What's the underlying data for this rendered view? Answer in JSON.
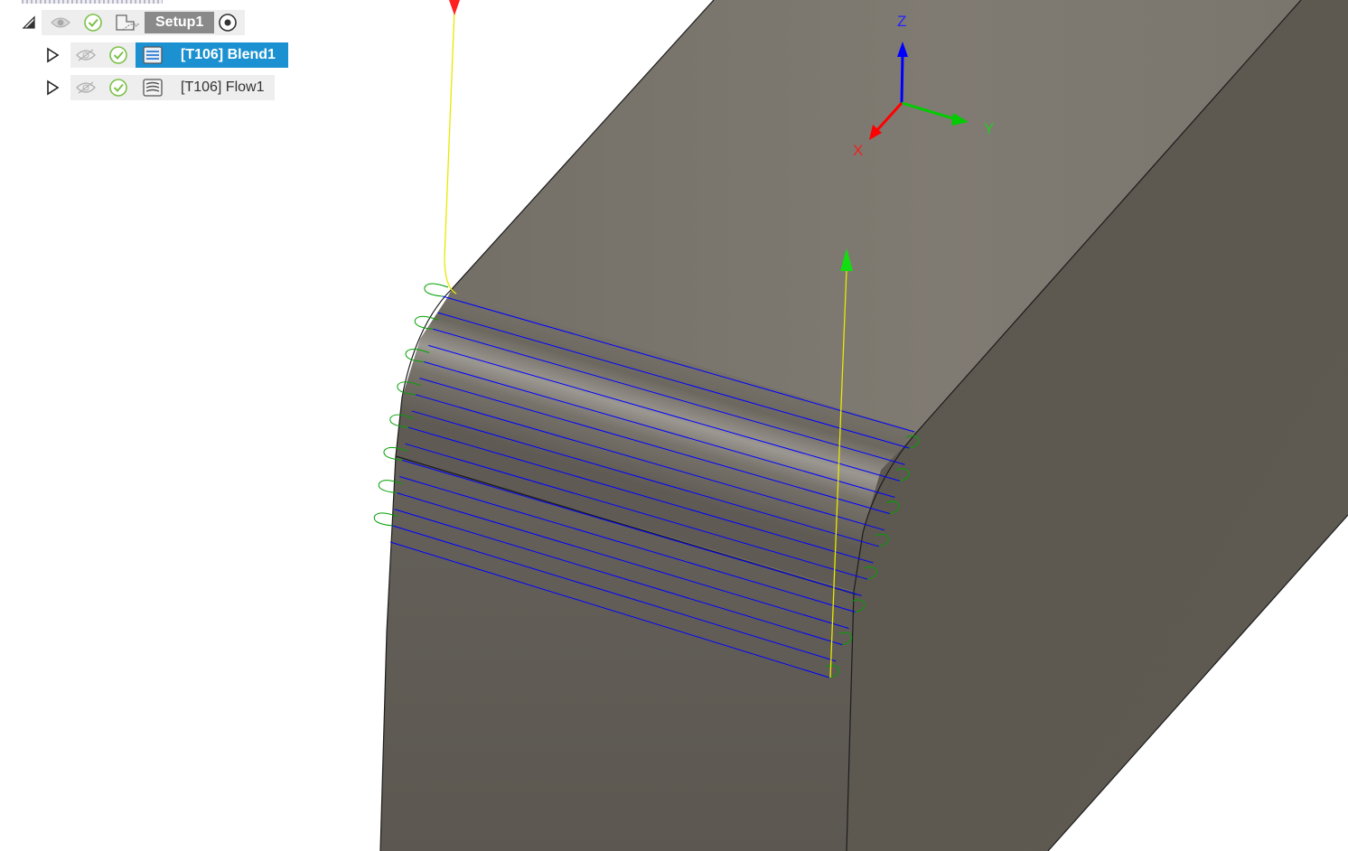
{
  "browser": {
    "setup": {
      "label": "Setup1",
      "icons": [
        "collapse-triangle-icon",
        "eye-icon",
        "check-icon",
        "setup-icon",
        "target-icon"
      ]
    },
    "operations": [
      {
        "label": "[T106] Blend1",
        "selected": true,
        "visible": false,
        "valid": true,
        "icon": "blend-toolpath-icon"
      },
      {
        "label": "[T106] Flow1",
        "selected": false,
        "visible": false,
        "valid": true,
        "icon": "flow-toolpath-icon"
      }
    ]
  },
  "view_cube": {
    "axes": {
      "z": "Z",
      "y": "Y",
      "x": "X"
    },
    "colors": {
      "z": "#0000ff",
      "y": "#00cc00",
      "x": "#ff0000"
    }
  },
  "colors": {
    "selection": "#1b91d1",
    "toolpath": "#0000ff",
    "lead": "#00aa00",
    "rapid": "#ffff00",
    "part_top": "#7c7870",
    "part_side": "#5e5a53"
  }
}
